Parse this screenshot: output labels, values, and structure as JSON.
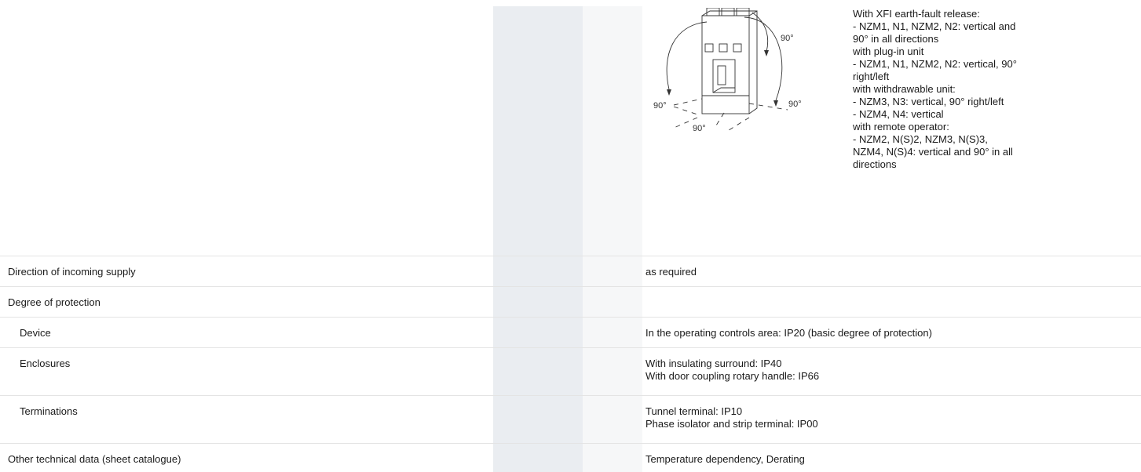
{
  "figure": {
    "angle_labels": [
      "90°",
      "90°",
      "90°",
      "90°"
    ]
  },
  "mounting_notes": [
    "With XFI earth-fault release:",
    "- NZM1, N1, NZM2, N2: vertical and",
    "90° in all directions",
    "with plug-in unit",
    "- NZM1, N1, NZM2, N2: vertical, 90°",
    "right/left",
    "with withdrawable unit:",
    "- NZM3, N3: vertical, 90° right/left",
    "- NZM4, N4: vertical",
    "with remote operator:",
    "- NZM2, N(S)2, NZM3, N(S)3,",
    "NZM4, N(S)4: vertical and 90° in all",
    "directions"
  ],
  "rows": [
    {
      "label": "Direction of incoming supply",
      "value_lines": [
        "as required"
      ]
    },
    {
      "label": "Degree of protection",
      "value_lines": []
    },
    {
      "label": "Device",
      "value_lines": [
        "In the operating controls area: IP20 (basic degree of protection)"
      ]
    },
    {
      "label": "Enclosures",
      "value_lines": [
        "With insulating surround: IP40",
        "With door coupling rotary handle: IP66"
      ]
    },
    {
      "label": "Terminations",
      "value_lines": [
        "Tunnel terminal: IP10",
        "Phase isolator and strip terminal: IP00"
      ]
    },
    {
      "label": "Other technical data (sheet catalogue)",
      "value_lines": [
        "Temperature dependency, Derating"
      ]
    }
  ]
}
